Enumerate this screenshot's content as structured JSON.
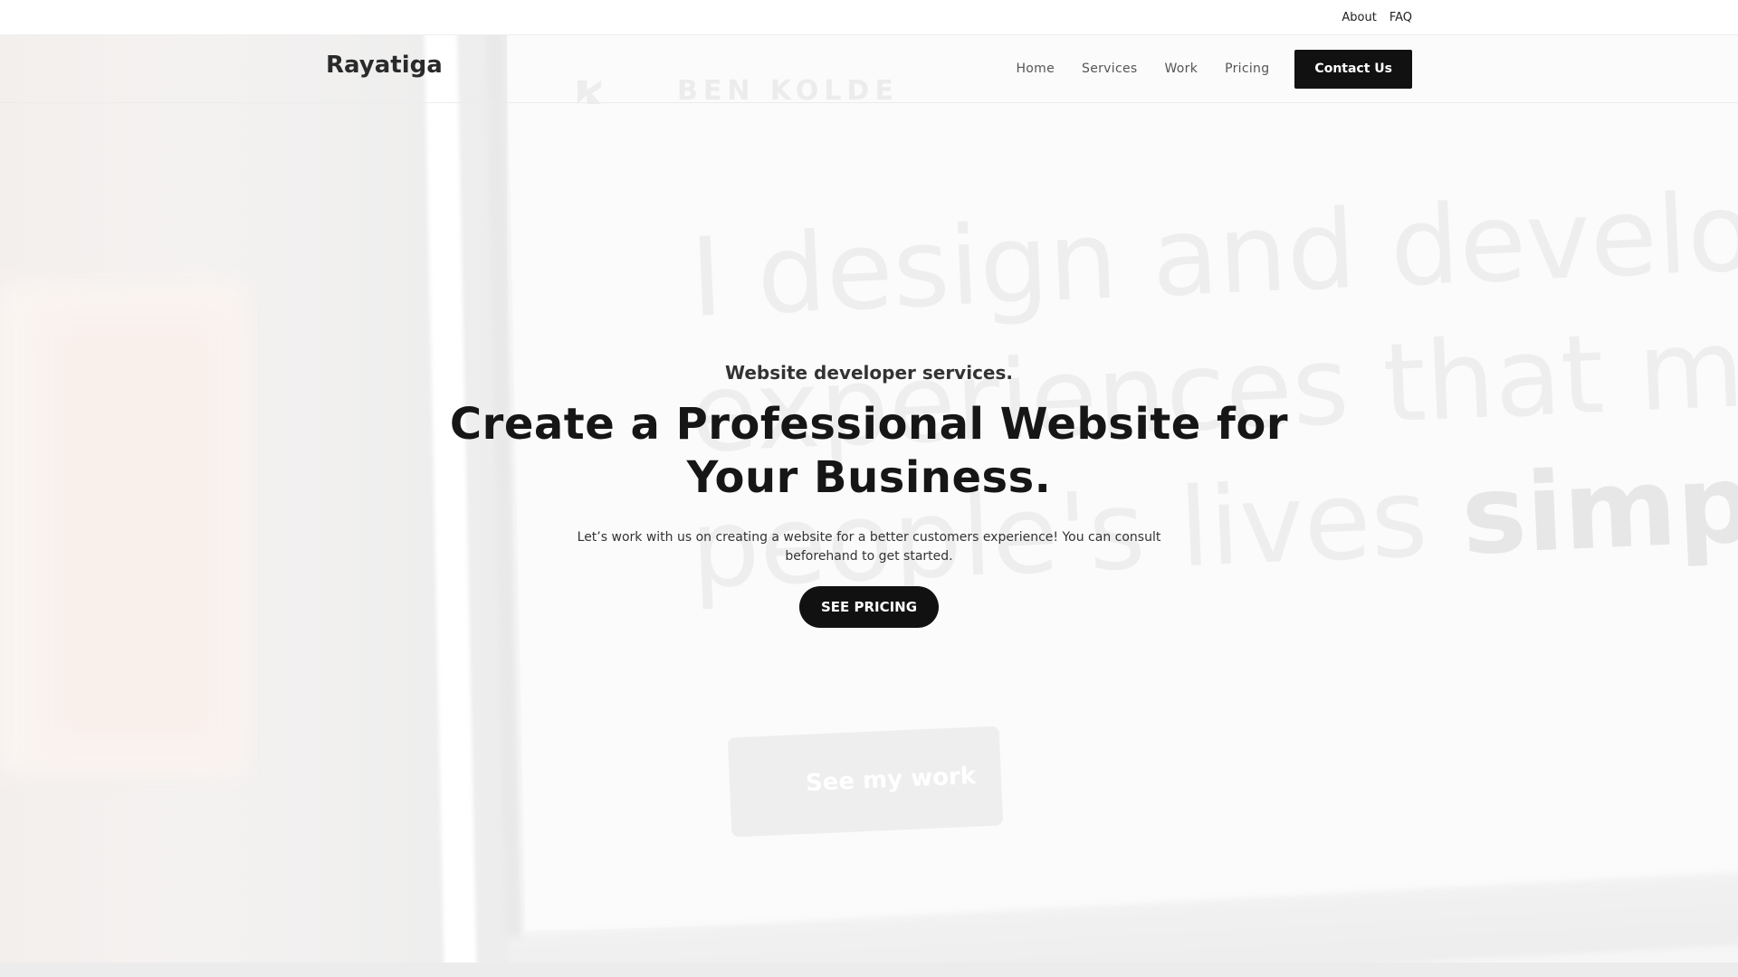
{
  "topbar": {
    "links": [
      "About",
      "FAQ"
    ]
  },
  "header": {
    "logo": "Rayatiga",
    "nav": [
      "Home",
      "Services",
      "Work",
      "Pricing"
    ],
    "contact_label": "Contact Us"
  },
  "background": {
    "brand": "BEN KOLDE",
    "lines": [
      "I design and develop",
      "experiences that mak",
      "people's lives"
    ],
    "line3_strong": "simple.",
    "cta": "See my work"
  },
  "hero": {
    "eyebrow": "Website developer services.",
    "headline": "Create a Professional Website for Your Business.",
    "subtext": "Let’s work with us on creating a website for a better customers experience! You can consult beforehand to get started.",
    "cta_label": "SEE PRICING"
  },
  "colors": {
    "primary": "#111111",
    "text": "#161616",
    "nav_text": "#555555",
    "background": "#f6f6f6"
  }
}
